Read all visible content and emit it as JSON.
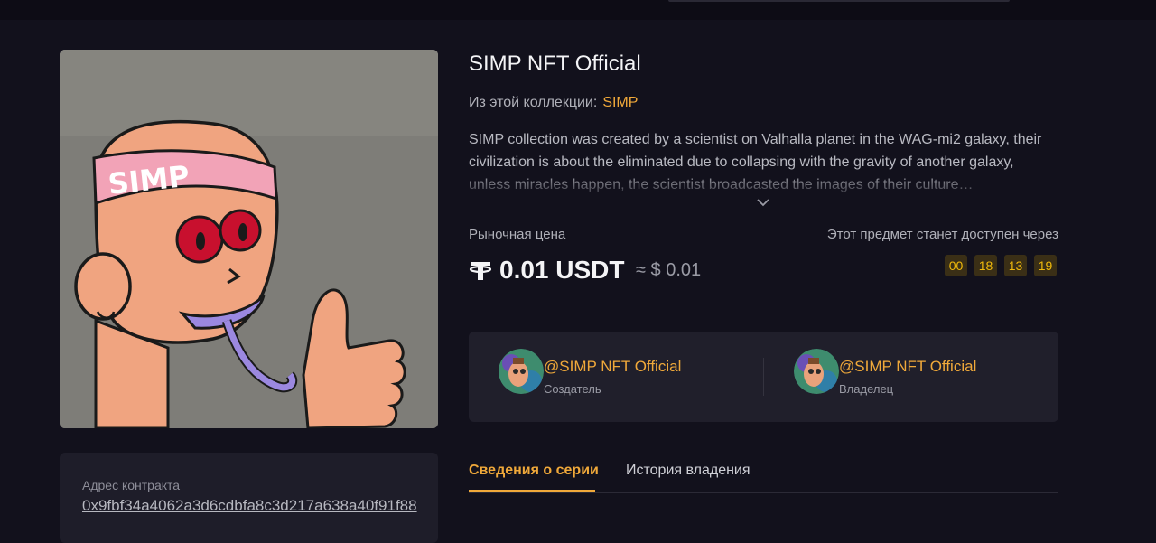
{
  "nft": {
    "title": "SIMP NFT Official",
    "collection_label": "Из этой коллекции:",
    "collection_name": "SIMP",
    "headband_text": "SIMP",
    "description": "SIMP collection was created by a scientist on Valhalla planet in the WAG-mi2 galaxy, their civilization is about the eliminated due to collapsing with the gravity of another galaxy, unless miracles happen, the scientist broadcasted the images of their culture…"
  },
  "price": {
    "label": "Рыночная цена",
    "amount": "0.01 USDT",
    "usd": "≈ $ 0.01",
    "currency_icon": "tether-icon"
  },
  "availability": {
    "label": "Этот предмет станет доступен через",
    "countdown": [
      "00",
      "18",
      "13",
      "19"
    ]
  },
  "people": {
    "creator": {
      "name": "@SIMP NFT Official",
      "role": "Создатель"
    },
    "owner": {
      "name": "@SIMP NFT Official",
      "role": "Владелец"
    }
  },
  "tabs": [
    {
      "label": "Сведения о серии",
      "active": true
    },
    {
      "label": "История владения",
      "active": false
    }
  ],
  "contract": {
    "label": "Адрес контракта",
    "address": "0x9fbf34a4062a3d6cdbfa8c3d217a638a40f91f88"
  },
  "colors": {
    "accent": "#f0a93a",
    "background": "#12111c",
    "card": "#201f2b"
  }
}
